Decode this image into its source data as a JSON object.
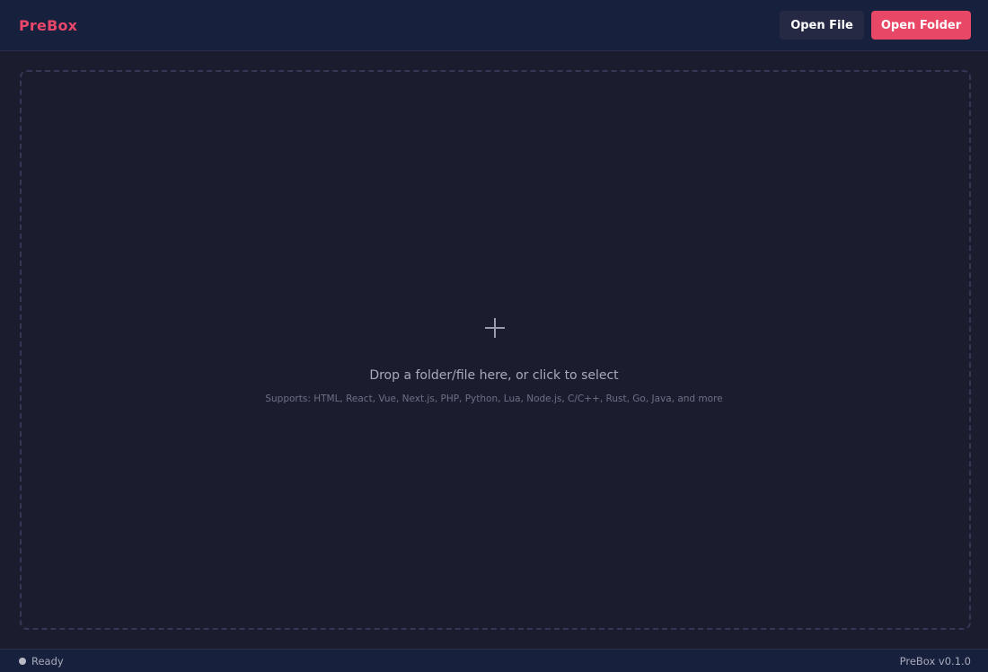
{
  "header": {
    "brand": "PreBox",
    "open_file_label": "Open File",
    "open_folder_label": "Open Folder"
  },
  "dropzone": {
    "icon": "plus-icon",
    "prompt": "Drop a folder/file here, or click to select",
    "supports": "Supports: HTML, React, Vue, Next.js, PHP, Python, Lua, Node.js, C/C++, Rust, Go, Java, and more"
  },
  "statusbar": {
    "status_icon": "status-dot-icon",
    "status": "Ready",
    "version": "PreBox v0.1.0"
  },
  "colors": {
    "accent": "#e84766",
    "brand_text": "#e8466b",
    "header_bg": "#17203d",
    "body_bg": "#1b1c2e",
    "secondary_button": "#252944"
  }
}
